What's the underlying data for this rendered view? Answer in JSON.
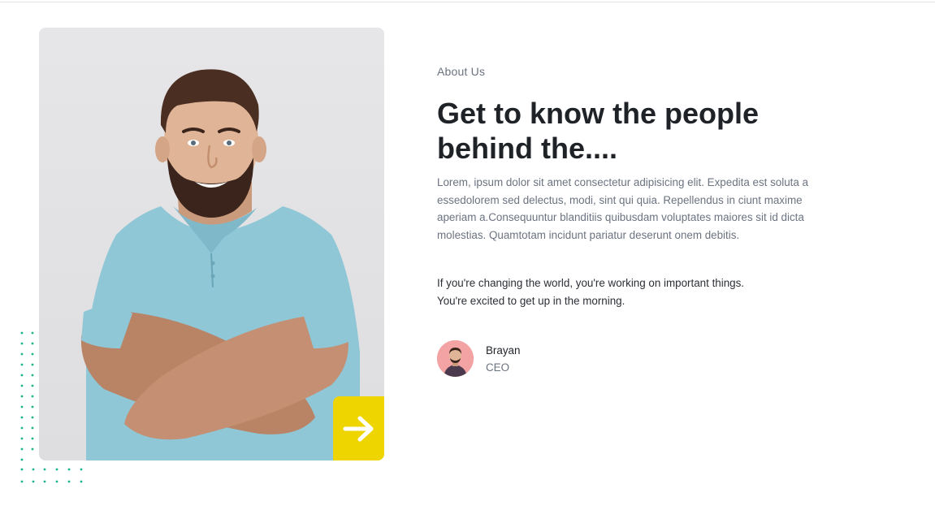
{
  "about": {
    "eyebrow": "About Us",
    "headline": "Get to know the people behind the....",
    "body": "Lorem, ipsum dolor sit amet consectetur adipisicing elit. Expedita est soluta a essedolorem sed delectus, modi, sint qui quia. Repellendus in ciunt maxime aperiam a.Consequuntur blanditiis quibusdam voluptates maiores sit id dicta molestias. Quamtotam incidunt pariatur deserunt onem debitis.",
    "quote_line1": "If you're changing the world, you're working on important things.",
    "quote_line2": "You're excited to get up in the morning."
  },
  "author": {
    "name": "Brayan",
    "role": "CEO"
  },
  "icons": {
    "arrow": "arrow-right-icon",
    "dots": "dot-pattern-icon"
  },
  "colors": {
    "accent_yellow": "#efd500",
    "dot_teal": "#19b58c",
    "shirt_blue": "#8fc7d6",
    "avatar_bg": "#f3a3a3"
  }
}
